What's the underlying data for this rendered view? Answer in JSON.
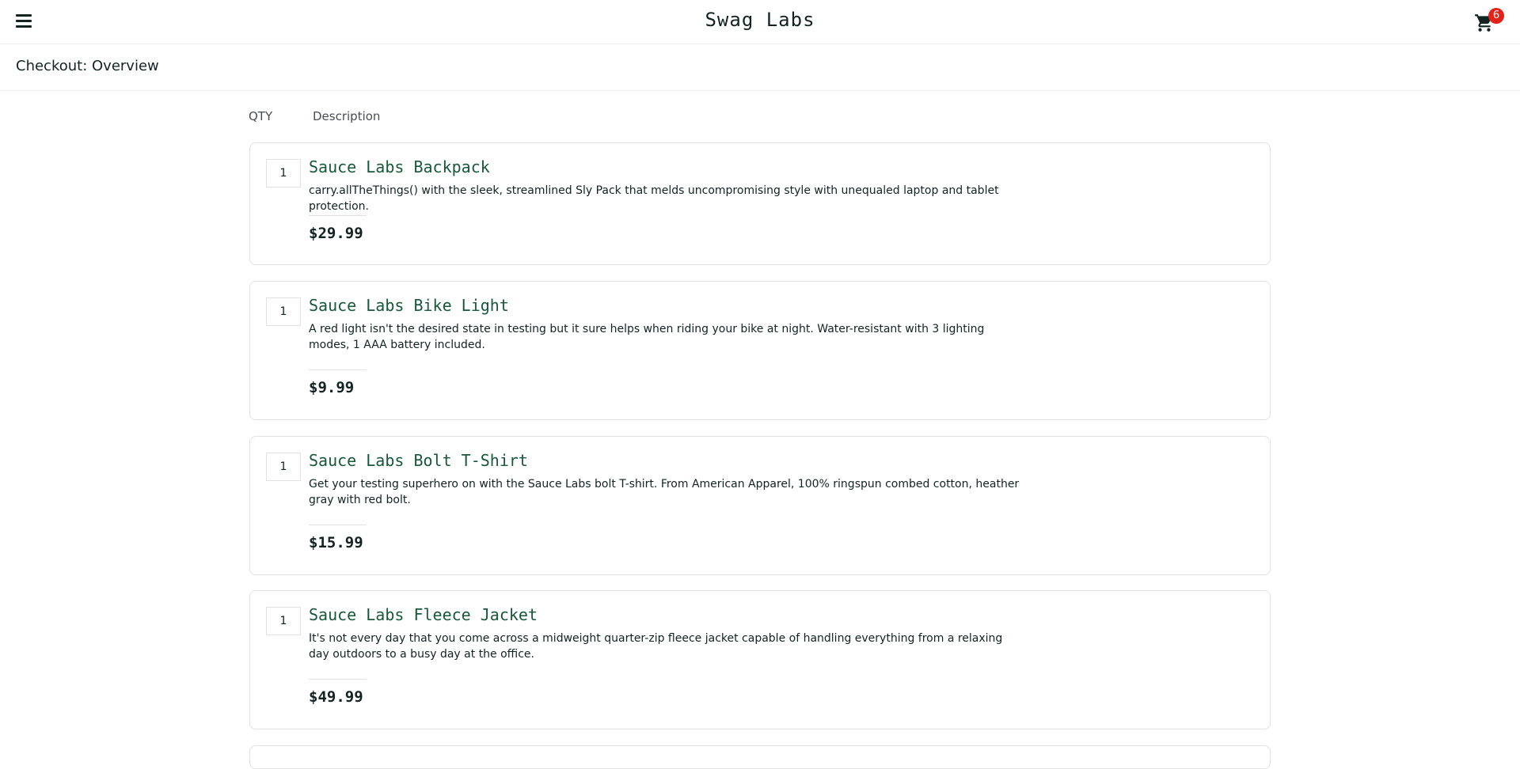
{
  "header": {
    "title": "Swag Labs",
    "cart_count": "6"
  },
  "page": {
    "title": "Checkout: Overview"
  },
  "columns": {
    "qty": "QTY",
    "description": "Description"
  },
  "items": [
    {
      "qty": "1",
      "name": "Sauce Labs Backpack",
      "description": "carry.allTheThings() with the sleek, streamlined Sly Pack that melds uncompromising style with unequaled laptop and tablet protection.",
      "price": "$29.99"
    },
    {
      "qty": "1",
      "name": "Sauce Labs Bike Light",
      "description": "A red light isn't the desired state in testing but it sure helps when riding your bike at night. Water-resistant with 3 lighting modes, 1 AAA battery included.",
      "price": "$9.99"
    },
    {
      "qty": "1",
      "name": "Sauce Labs Bolt T-Shirt",
      "description": "Get your testing superhero on with the Sauce Labs bolt T-shirt. From American Apparel, 100% ringspun combed cotton, heather gray with red bolt.",
      "price": "$15.99"
    },
    {
      "qty": "1",
      "name": "Sauce Labs Fleece Jacket",
      "description": "It's not every day that you come across a midweight quarter-zip fleece jacket capable of handling everything from a relaxing day outdoors to a busy day at the office.",
      "price": "$49.99"
    }
  ]
}
